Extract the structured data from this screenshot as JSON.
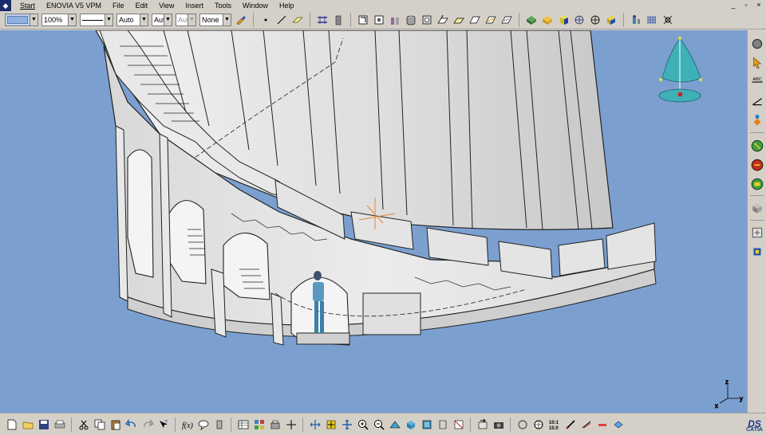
{
  "menubar": {
    "items": [
      "Start",
      "ENOVIA V5 VPM",
      "File",
      "Edit",
      "View",
      "Insert",
      "Tools",
      "Window",
      "Help"
    ]
  },
  "window_controls": {
    "minimize": "_",
    "restore": "▫",
    "close": "×"
  },
  "properties": {
    "zoom": "100%",
    "line_type": "Auto",
    "thickness": "Aut",
    "weight": "Aut",
    "layer": "None"
  },
  "compass": {
    "axis_z": "z",
    "axis_y": "y",
    "axis_x": "x"
  },
  "branding": {
    "ds": "DS",
    "catia": "CATIA"
  },
  "colors": {
    "viewport": "#7ba0d0",
    "ui": "#d4d0c8",
    "model": "#e6e6e6"
  },
  "icons": {
    "top": [
      "paint-icon",
      "point-icon",
      "line-icon",
      "plane-icon",
      "symmetry-icon",
      "tower-icon",
      "body-icon",
      "sketch-icon",
      "part-icon",
      "cylinder-icon",
      "box-icon",
      "extrude-icon",
      "cut-icon",
      "groove-icon",
      "rib-icon",
      "surface-icon",
      "material-icon",
      "render-icon",
      "cube-icon",
      "sphere-icon",
      "cross-icon",
      "fill-icon",
      "manikin-icon",
      "grid-icon",
      "snap-icon"
    ],
    "right": [
      "select-icon",
      "pointer-icon",
      "annotation-icon",
      "axis-icon",
      "measure-icon",
      "tree-icon",
      "sphere-red-icon",
      "sphere-green-icon",
      "part-design-icon",
      "assembly-icon",
      "catalog-icon"
    ],
    "bottom": [
      "new-icon",
      "open-icon",
      "save-icon",
      "print-icon",
      "cut-icon",
      "copy-icon",
      "paste-icon",
      "undo-icon",
      "redo-icon",
      "whats-this-icon",
      "formula-icon",
      "comment-icon",
      "knowledge-icon",
      "table-icon",
      "design-table-icon",
      "law-icon",
      "fly-icon",
      "fit-all-icon",
      "pan-icon",
      "rotate-icon",
      "zoom-in-icon",
      "zoom-out-icon",
      "normal-view-icon",
      "iso-view-icon",
      "multi-view-icon",
      "shading-icon",
      "hide-icon",
      "swap-icon",
      "capture-icon",
      "filter-icon",
      "walk-icon",
      "scale-icon",
      "ruler-icon",
      "animation-icon",
      "minus-icon",
      "box-select-icon"
    ]
  }
}
